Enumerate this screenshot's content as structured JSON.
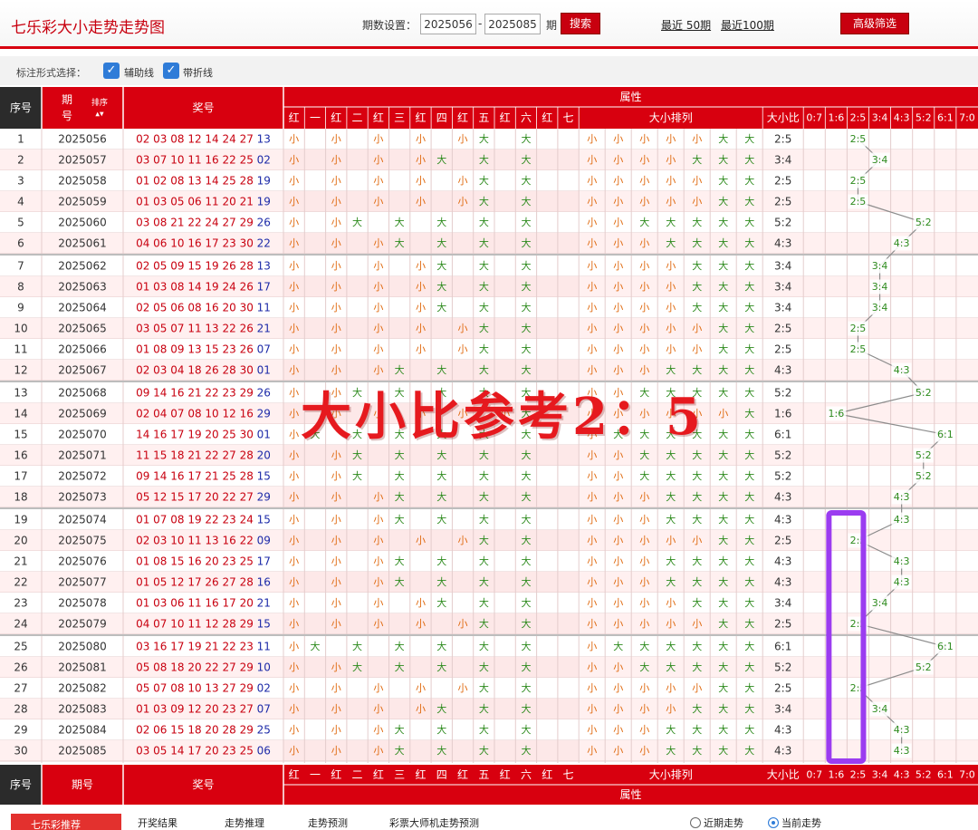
{
  "header": {
    "title": "七乐彩大小走势走势图",
    "period_label": "期数设置：",
    "from": "2025056",
    "sep": "-",
    "to": "2025085",
    "unit": "期",
    "search": "搜索",
    "recent50": "最近 50期",
    "recent100": "最近100期",
    "advanced": "高级筛选"
  },
  "options": {
    "label": "标注形式选择：",
    "aux": "辅助线",
    "fold": "带折线"
  },
  "columns": {
    "seq": "序号",
    "period": "期号",
    "sort": "排序",
    "prize": "奖号",
    "attr": "属性",
    "sub": [
      "红",
      "一",
      "红",
      "二",
      "红",
      "三",
      "红",
      "四",
      "红",
      "五",
      "红",
      "六",
      "红",
      "七"
    ],
    "arrange": "大小排列",
    "ratio": "大小比",
    "ratios": [
      "0:7",
      "1:6",
      "2:5",
      "3:4",
      "4:3",
      "5:2",
      "6:1",
      "7:0"
    ]
  },
  "watermark": "大小比参考2：5",
  "rows": [
    {
      "n": "1",
      "p": "2025056",
      "r": "02 03 08 12 14 24 27",
      "b": "13",
      "c": [
        "小",
        "",
        "小",
        "",
        "小",
        "",
        "小",
        "",
        "小",
        "大",
        "",
        "大",
        "",
        ""
      ],
      "a": [
        "小",
        "小",
        "小",
        "小",
        "小",
        "大",
        "大"
      ],
      "ratio": "2:5"
    },
    {
      "n": "2",
      "p": "2025057",
      "r": "03 07 10 11 16 22 25",
      "b": "02",
      "c": [
        "小",
        "",
        "小",
        "",
        "小",
        "",
        "小",
        "大",
        "",
        "大",
        "",
        "大",
        "",
        ""
      ],
      "a": [
        "小",
        "小",
        "小",
        "小",
        "大",
        "大",
        "大"
      ],
      "ratio": "3:4"
    },
    {
      "n": "3",
      "p": "2025058",
      "r": "01 02 08 13 14 25 28",
      "b": "19",
      "c": [
        "小",
        "",
        "小",
        "",
        "小",
        "",
        "小",
        "",
        "小",
        "大",
        "",
        "大",
        "",
        ""
      ],
      "a": [
        "小",
        "小",
        "小",
        "小",
        "小",
        "大",
        "大"
      ],
      "ratio": "2:5"
    },
    {
      "n": "4",
      "p": "2025059",
      "r": "01 03 05 06 11 20 21",
      "b": "19",
      "c": [
        "小",
        "",
        "小",
        "",
        "小",
        "",
        "小",
        "",
        "小",
        "大",
        "",
        "大",
        "",
        ""
      ],
      "a": [
        "小",
        "小",
        "小",
        "小",
        "小",
        "大",
        "大"
      ],
      "ratio": "2:5"
    },
    {
      "n": "5",
      "p": "2025060",
      "r": "03 08 21 22 24 27 29",
      "b": "26",
      "c": [
        "小",
        "",
        "小",
        "大",
        "",
        "大",
        "",
        "大",
        "",
        "大",
        "",
        "大",
        "",
        ""
      ],
      "a": [
        "小",
        "小",
        "大",
        "大",
        "大",
        "大",
        "大"
      ],
      "ratio": "5:2"
    },
    {
      "n": "6",
      "p": "2025061",
      "r": "04 06 10 16 17 23 30",
      "b": "22",
      "c": [
        "小",
        "",
        "小",
        "",
        "小",
        "大",
        "",
        "大",
        "",
        "大",
        "",
        "大",
        "",
        ""
      ],
      "a": [
        "小",
        "小",
        "小",
        "大",
        "大",
        "大",
        "大"
      ],
      "ratio": "4:3"
    },
    {
      "n": "7",
      "p": "2025062",
      "r": "02 05 09 15 19 26 28",
      "b": "13",
      "c": [
        "小",
        "",
        "小",
        "",
        "小",
        "",
        "小",
        "大",
        "",
        "大",
        "",
        "大",
        "",
        ""
      ],
      "a": [
        "小",
        "小",
        "小",
        "小",
        "大",
        "大",
        "大"
      ],
      "ratio": "3:4"
    },
    {
      "n": "8",
      "p": "2025063",
      "r": "01 03 08 14 19 24 26",
      "b": "17",
      "c": [
        "小",
        "",
        "小",
        "",
        "小",
        "",
        "小",
        "大",
        "",
        "大",
        "",
        "大",
        "",
        ""
      ],
      "a": [
        "小",
        "小",
        "小",
        "小",
        "大",
        "大",
        "大"
      ],
      "ratio": "3:4"
    },
    {
      "n": "9",
      "p": "2025064",
      "r": "02 05 06 08 16 20 30",
      "b": "11",
      "c": [
        "小",
        "",
        "小",
        "",
        "小",
        "",
        "小",
        "大",
        "",
        "大",
        "",
        "大",
        "",
        ""
      ],
      "a": [
        "小",
        "小",
        "小",
        "小",
        "大",
        "大",
        "大"
      ],
      "ratio": "3:4"
    },
    {
      "n": "10",
      "p": "2025065",
      "r": "03 05 07 11 13 22 26",
      "b": "21",
      "c": [
        "小",
        "",
        "小",
        "",
        "小",
        "",
        "小",
        "",
        "小",
        "大",
        "",
        "大",
        "",
        ""
      ],
      "a": [
        "小",
        "小",
        "小",
        "小",
        "小",
        "大",
        "大"
      ],
      "ratio": "2:5"
    },
    {
      "n": "11",
      "p": "2025066",
      "r": "01 08 09 13 15 23 26",
      "b": "07",
      "c": [
        "小",
        "",
        "小",
        "",
        "小",
        "",
        "小",
        "",
        "小",
        "大",
        "",
        "大",
        "",
        ""
      ],
      "a": [
        "小",
        "小",
        "小",
        "小",
        "小",
        "大",
        "大"
      ],
      "ratio": "2:5"
    },
    {
      "n": "12",
      "p": "2025067",
      "r": "02 03 04 18 26 28 30",
      "b": "01",
      "c": [
        "小",
        "",
        "小",
        "",
        "小",
        "大",
        "",
        "大",
        "",
        "大",
        "",
        "大",
        "",
        ""
      ],
      "a": [
        "小",
        "小",
        "小",
        "大",
        "大",
        "大",
        "大"
      ],
      "ratio": "4:3"
    },
    {
      "n": "13",
      "p": "2025068",
      "r": "09 14 16 21 22 23 29",
      "b": "26",
      "c": [
        "小",
        "",
        "小",
        "大",
        "",
        "大",
        "",
        "大",
        "",
        "大",
        "",
        "大",
        "",
        ""
      ],
      "a": [
        "小",
        "小",
        "大",
        "大",
        "大",
        "大",
        "大"
      ],
      "ratio": "5:2"
    },
    {
      "n": "14",
      "p": "2025069",
      "r": "02 04 07 08 10 12 16",
      "b": "29",
      "c": [
        "小",
        "",
        "小",
        "",
        "小",
        "",
        "小",
        "",
        "小",
        "",
        "小",
        "大",
        "",
        ""
      ],
      "a": [
        "小",
        "小",
        "小",
        "小",
        "小",
        "小",
        "大"
      ],
      "ratio": "1:6"
    },
    {
      "n": "15",
      "p": "2025070",
      "r": "14 16 17 19 20 25 30",
      "b": "01",
      "c": [
        "小",
        "大",
        "",
        "大",
        "",
        "大",
        "",
        "大",
        "",
        "大",
        "",
        "大",
        "",
        ""
      ],
      "a": [
        "小",
        "大",
        "大",
        "大",
        "大",
        "大",
        "大"
      ],
      "ratio": "6:1"
    },
    {
      "n": "16",
      "p": "2025071",
      "r": "11 15 18 21 22 27 28",
      "b": "20",
      "c": [
        "小",
        "",
        "小",
        "大",
        "",
        "大",
        "",
        "大",
        "",
        "大",
        "",
        "大",
        "",
        ""
      ],
      "a": [
        "小",
        "小",
        "大",
        "大",
        "大",
        "大",
        "大"
      ],
      "ratio": "5:2"
    },
    {
      "n": "17",
      "p": "2025072",
      "r": "09 14 16 17 21 25 28",
      "b": "15",
      "c": [
        "小",
        "",
        "小",
        "大",
        "",
        "大",
        "",
        "大",
        "",
        "大",
        "",
        "大",
        "",
        ""
      ],
      "a": [
        "小",
        "小",
        "大",
        "大",
        "大",
        "大",
        "大"
      ],
      "ratio": "5:2"
    },
    {
      "n": "18",
      "p": "2025073",
      "r": "05 12 15 17 20 22 27",
      "b": "29",
      "c": [
        "小",
        "",
        "小",
        "",
        "小",
        "大",
        "",
        "大",
        "",
        "大",
        "",
        "大",
        "",
        ""
      ],
      "a": [
        "小",
        "小",
        "小",
        "大",
        "大",
        "大",
        "大"
      ],
      "ratio": "4:3"
    },
    {
      "n": "19",
      "p": "2025074",
      "r": "01 07 08 19 22 23 24",
      "b": "15",
      "c": [
        "小",
        "",
        "小",
        "",
        "小",
        "大",
        "",
        "大",
        "",
        "大",
        "",
        "大",
        "",
        ""
      ],
      "a": [
        "小",
        "小",
        "小",
        "大",
        "大",
        "大",
        "大"
      ],
      "ratio": "4:3"
    },
    {
      "n": "20",
      "p": "2025075",
      "r": "02 03 10 11 13 16 22",
      "b": "09",
      "c": [
        "小",
        "",
        "小",
        "",
        "小",
        "",
        "小",
        "",
        "小",
        "大",
        "",
        "大",
        "",
        ""
      ],
      "a": [
        "小",
        "小",
        "小",
        "小",
        "小",
        "大",
        "大"
      ],
      "ratio": "2:5"
    },
    {
      "n": "21",
      "p": "2025076",
      "r": "01 08 15 16 20 23 25",
      "b": "17",
      "c": [
        "小",
        "",
        "小",
        "",
        "小",
        "大",
        "",
        "大",
        "",
        "大",
        "",
        "大",
        "",
        ""
      ],
      "a": [
        "小",
        "小",
        "小",
        "大",
        "大",
        "大",
        "大"
      ],
      "ratio": "4:3"
    },
    {
      "n": "22",
      "p": "2025077",
      "r": "01 05 12 17 26 27 28",
      "b": "16",
      "c": [
        "小",
        "",
        "小",
        "",
        "小",
        "大",
        "",
        "大",
        "",
        "大",
        "",
        "大",
        "",
        ""
      ],
      "a": [
        "小",
        "小",
        "小",
        "大",
        "大",
        "大",
        "大"
      ],
      "ratio": "4:3"
    },
    {
      "n": "23",
      "p": "2025078",
      "r": "01 03 06 11 16 17 20",
      "b": "21",
      "c": [
        "小",
        "",
        "小",
        "",
        "小",
        "",
        "小",
        "大",
        "",
        "大",
        "",
        "大",
        "",
        ""
      ],
      "a": [
        "小",
        "小",
        "小",
        "小",
        "大",
        "大",
        "大"
      ],
      "ratio": "3:4"
    },
    {
      "n": "24",
      "p": "2025079",
      "r": "04 07 10 11 12 28 29",
      "b": "15",
      "c": [
        "小",
        "",
        "小",
        "",
        "小",
        "",
        "小",
        "",
        "小",
        "大",
        "",
        "大",
        "",
        ""
      ],
      "a": [
        "小",
        "小",
        "小",
        "小",
        "小",
        "大",
        "大"
      ],
      "ratio": "2:5"
    },
    {
      "n": "25",
      "p": "2025080",
      "r": "03 16 17 19 21 22 23",
      "b": "11",
      "c": [
        "小",
        "大",
        "",
        "大",
        "",
        "大",
        "",
        "大",
        "",
        "大",
        "",
        "大",
        "",
        ""
      ],
      "a": [
        "小",
        "大",
        "大",
        "大",
        "大",
        "大",
        "大"
      ],
      "ratio": "6:1"
    },
    {
      "n": "26",
      "p": "2025081",
      "r": "05 08 18 20 22 27 29",
      "b": "10",
      "c": [
        "小",
        "",
        "小",
        "大",
        "",
        "大",
        "",
        "大",
        "",
        "大",
        "",
        "大",
        "",
        ""
      ],
      "a": [
        "小",
        "小",
        "大",
        "大",
        "大",
        "大",
        "大"
      ],
      "ratio": "5:2"
    },
    {
      "n": "27",
      "p": "2025082",
      "r": "05 07 08 10 13 27 29",
      "b": "02",
      "c": [
        "小",
        "",
        "小",
        "",
        "小",
        "",
        "小",
        "",
        "小",
        "大",
        "",
        "大",
        "",
        ""
      ],
      "a": [
        "小",
        "小",
        "小",
        "小",
        "小",
        "大",
        "大"
      ],
      "ratio": "2:5"
    },
    {
      "n": "28",
      "p": "2025083",
      "r": "01 03 09 12 20 23 27",
      "b": "07",
      "c": [
        "小",
        "",
        "小",
        "",
        "小",
        "",
        "小",
        "大",
        "",
        "大",
        "",
        "大",
        "",
        ""
      ],
      "a": [
        "小",
        "小",
        "小",
        "小",
        "大",
        "大",
        "大"
      ],
      "ratio": "3:4"
    },
    {
      "n": "29",
      "p": "2025084",
      "r": "02 06 15 18 20 28 29",
      "b": "25",
      "c": [
        "小",
        "",
        "小",
        "",
        "小",
        "大",
        "",
        "大",
        "",
        "大",
        "",
        "大",
        "",
        ""
      ],
      "a": [
        "小",
        "小",
        "小",
        "大",
        "大",
        "大",
        "大"
      ],
      "ratio": "4:3"
    },
    {
      "n": "30",
      "p": "2025085",
      "r": "03 05 14 17 20 23 25",
      "b": "06",
      "c": [
        "小",
        "",
        "小",
        "",
        "小",
        "大",
        "",
        "大",
        "",
        "大",
        "",
        "大",
        "",
        ""
      ],
      "a": [
        "小",
        "小",
        "小",
        "大",
        "大",
        "大",
        "大"
      ],
      "ratio": "4:3"
    }
  ],
  "footer": {
    "tab": "七乐彩推荐",
    "items": [
      "开奖结果",
      "走势推理",
      "走势预测",
      "彩票大师机走势预测"
    ],
    "radio1": "近期走势",
    "radio2": "当前走势"
  },
  "colors": {
    "red": "#d8000f",
    "small": "#e06a10",
    "big": "#2e8b1e",
    "blue": "#1c2aa8",
    "highlight": "#9b3cf0"
  }
}
